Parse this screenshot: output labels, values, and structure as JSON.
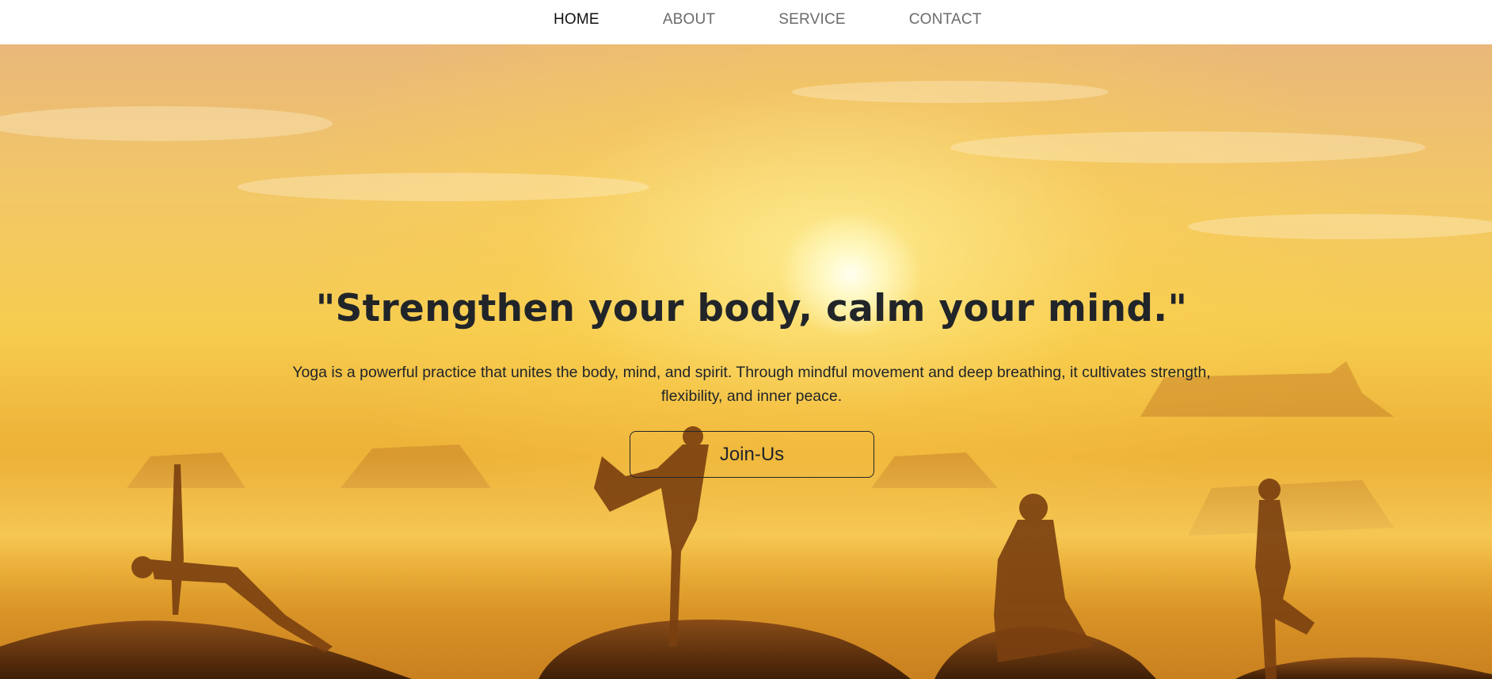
{
  "nav": {
    "items": [
      {
        "label": "HOME",
        "active": true
      },
      {
        "label": "ABOUT",
        "active": false
      },
      {
        "label": "SERVICE",
        "active": false
      },
      {
        "label": "CONTACT",
        "active": false
      }
    ]
  },
  "hero": {
    "title": "\"Strengthen your body, calm your mind.\"",
    "description": "Yoga is a powerful practice that unites the body, mind, and spirit. Through mindful movement and deep breathing, it cultivates strength, flexibility, and inner peace.",
    "button_label": "Join-Us",
    "image": "sunrise-yoga-silhouettes",
    "colors": {
      "sky": "#f6cc4f",
      "sun": "#fffbe8",
      "silhouette": "#6b3a12",
      "text": "#212529"
    }
  }
}
